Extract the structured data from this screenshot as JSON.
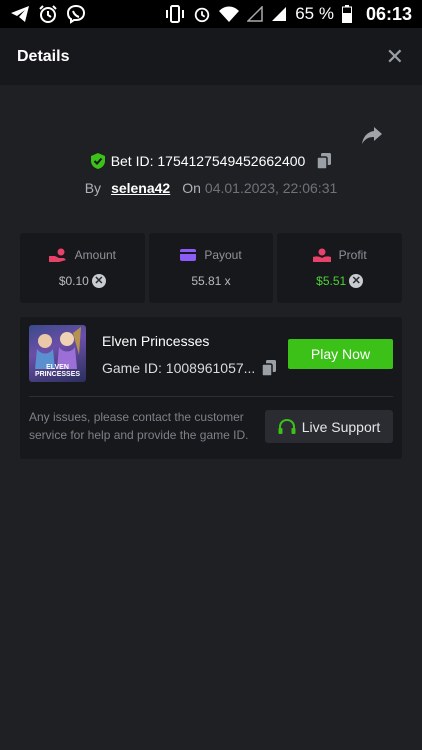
{
  "status_bar": {
    "battery_percent": "65 %",
    "time": "06:13",
    "left_icons": [
      "telegram-icon",
      "alarm-icon",
      "viber-icon"
    ],
    "right_icons": [
      "vibrate-icon",
      "alarm-icon",
      "wifi-icon",
      "signal-empty-icon",
      "signal-icon",
      "battery-icon"
    ]
  },
  "header": {
    "title": "Details",
    "close_label": "✕"
  },
  "bet": {
    "id_text": "Bet ID: 1754127549452662400",
    "by_label": "By",
    "username": "selena42",
    "on_label": "On",
    "date": "04.01.2023, 22:06:31"
  },
  "stats": [
    {
      "label": "Amount",
      "value": "$0.10",
      "icon": "amount-hand-icon",
      "color": "#e8416a"
    },
    {
      "label": "Payout",
      "value": "55.81 x",
      "icon": "card-icon",
      "color": "#8b5cf6"
    },
    {
      "label": "Profit",
      "value": "$5.51",
      "icon": "profit-hand-icon",
      "color": "#e8416a"
    }
  ],
  "game": {
    "name": "Elven Princesses",
    "id_text": "Game ID: 1008961057...",
    "thumb_text": "ELVEN PRINCESSES",
    "play_label": "Play Now",
    "issues_text": "Any issues, please contact the customer service for help and provide the game ID.",
    "support_label": "Live Support"
  },
  "colors": {
    "accent_green": "#3bc118",
    "profit_green": "#4cd137",
    "background": "#1e2024",
    "card": "#17181c"
  }
}
